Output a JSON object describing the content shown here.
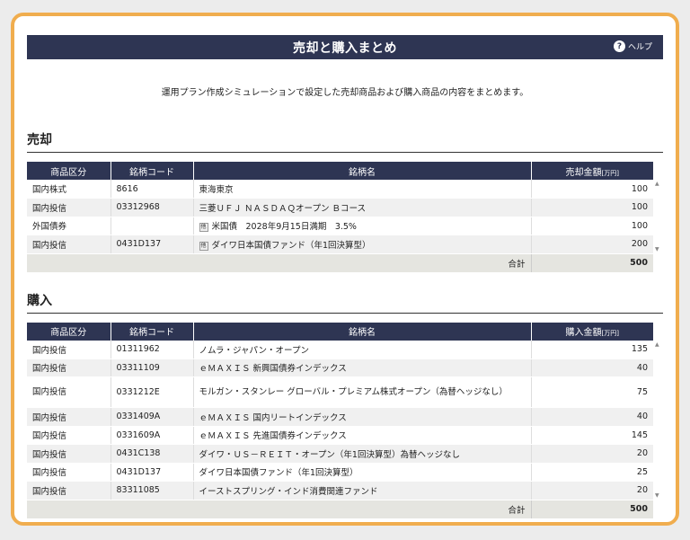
{
  "page": {
    "title": "売却と購入まとめ",
    "help_label": "ヘルプ",
    "help_glyph": "?",
    "description": "運用プラン作成シミュレーションで設定した売却商品および購入商品の内容をまとめます。"
  },
  "sell": {
    "heading": "売却",
    "columns": [
      "商品区分",
      "銘柄コード",
      "銘柄名",
      "売却金額"
    ],
    "unit": "[万円]",
    "rows": [
      {
        "category": "国内株式",
        "code": "8616",
        "name": "東海東京",
        "badge": "",
        "amount": "100"
      },
      {
        "category": "国内投信",
        "code": "03312968",
        "name": "三菱ＵＦＪ ＮＡＳＤＡＱオープン Ｂコース",
        "badge": "",
        "amount": "100"
      },
      {
        "category": "外国債券",
        "code": "",
        "name": "米国債　2028年9月15日満期　3.5%",
        "badge": "他",
        "amount": "100"
      },
      {
        "category": "国内投信",
        "code": "0431D137",
        "name": "ダイワ日本国債ファンド（年1回決算型）",
        "badge": "他",
        "amount": "200"
      }
    ],
    "total_label": "合計",
    "total_value": "500"
  },
  "buy": {
    "heading": "購入",
    "columns": [
      "商品区分",
      "銘柄コード",
      "銘柄名",
      "購入金額"
    ],
    "unit": "[万円]",
    "rows": [
      {
        "category": "国内投信",
        "code": "01311962",
        "name": "ノムラ・ジャパン・オープン",
        "amount": "135"
      },
      {
        "category": "国内投信",
        "code": "03311109",
        "name": "ｅＭＡＸＩＳ 新興国債券インデックス",
        "amount": "40"
      },
      {
        "category": "国内投信",
        "code": "0331212E",
        "name": "モルガン・スタンレー グローバル・プレミアム株式オープン（為替ヘッジなし）",
        "amount": "75"
      },
      {
        "category": "国内投信",
        "code": "0331409A",
        "name": "ｅＭＡＸＩＳ 国内リートインデックス",
        "amount": "40"
      },
      {
        "category": "国内投信",
        "code": "0331609A",
        "name": "ｅＭＡＸＩＳ 先進国債券インデックス",
        "amount": "145"
      },
      {
        "category": "国内投信",
        "code": "0431C138",
        "name": "ダイワ・ＵＳ－ＲＥＩＴ・オープン（年1回決算型）為替ヘッジなし",
        "amount": "20"
      },
      {
        "category": "国内投信",
        "code": "0431D137",
        "name": "ダイワ日本国債ファンド（年1回決算型）",
        "amount": "25"
      },
      {
        "category": "国内投信",
        "code": "83311085",
        "name": "イーストスプリング・インド消費関連ファンド",
        "amount": "20"
      }
    ],
    "total_label": "合計",
    "total_value": "500"
  },
  "colors": {
    "header_navy": "#2e3553",
    "frame_orange": "#f0ad4e"
  }
}
